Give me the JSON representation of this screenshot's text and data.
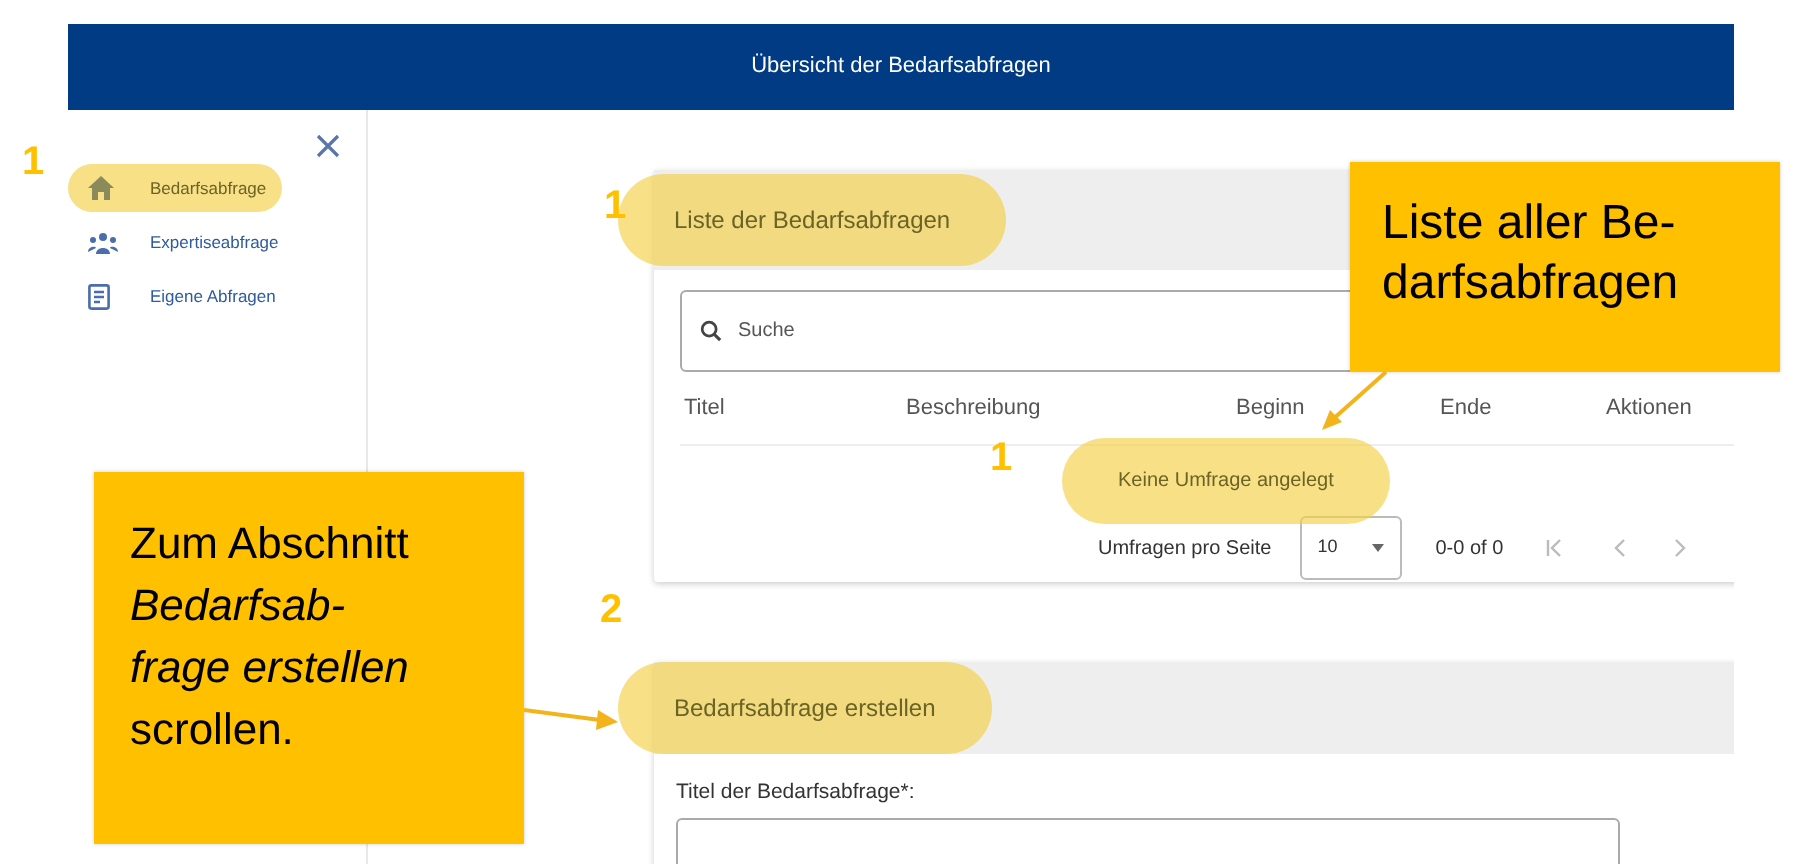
{
  "header": {
    "title": "Übersicht der Bedarfsabfragen"
  },
  "sidebar": {
    "items": [
      {
        "label": "Bedarfsabfrage",
        "highlighted": true,
        "marker": "1"
      },
      {
        "label": "Expertiseabfrage",
        "highlighted": false
      },
      {
        "label": "Eigene Abfragen",
        "highlighted": false
      }
    ]
  },
  "list_section": {
    "title": "Liste der Bedarfsabfragen",
    "title_highlighted": true,
    "title_marker": "1",
    "search": {
      "placeholder": "Suche"
    },
    "table": {
      "columns": [
        "Titel",
        "Beschreibung",
        "Beginn",
        "Ende",
        "Aktionen"
      ],
      "empty_message": "Keine Umfrage angelegt",
      "empty_highlighted": true,
      "empty_marker": "1"
    },
    "pagination": {
      "label": "Umfragen pro Seite",
      "page_size": "10",
      "range": "0-0 of 0"
    }
  },
  "create_section": {
    "title": "Bedarfsabfrage erstellen",
    "title_highlighted": true,
    "title_marker": "2",
    "fields": [
      {
        "label": "Titel der Bedarfsabfrage*:"
      }
    ]
  },
  "callouts": [
    {
      "text": "Liste aller Be-\ndarfsabfragen"
    },
    {
      "text": "Zum Abschnitt\n*Bedarfsab-*\n*frage erstellen*\nscrollen."
    }
  ]
}
